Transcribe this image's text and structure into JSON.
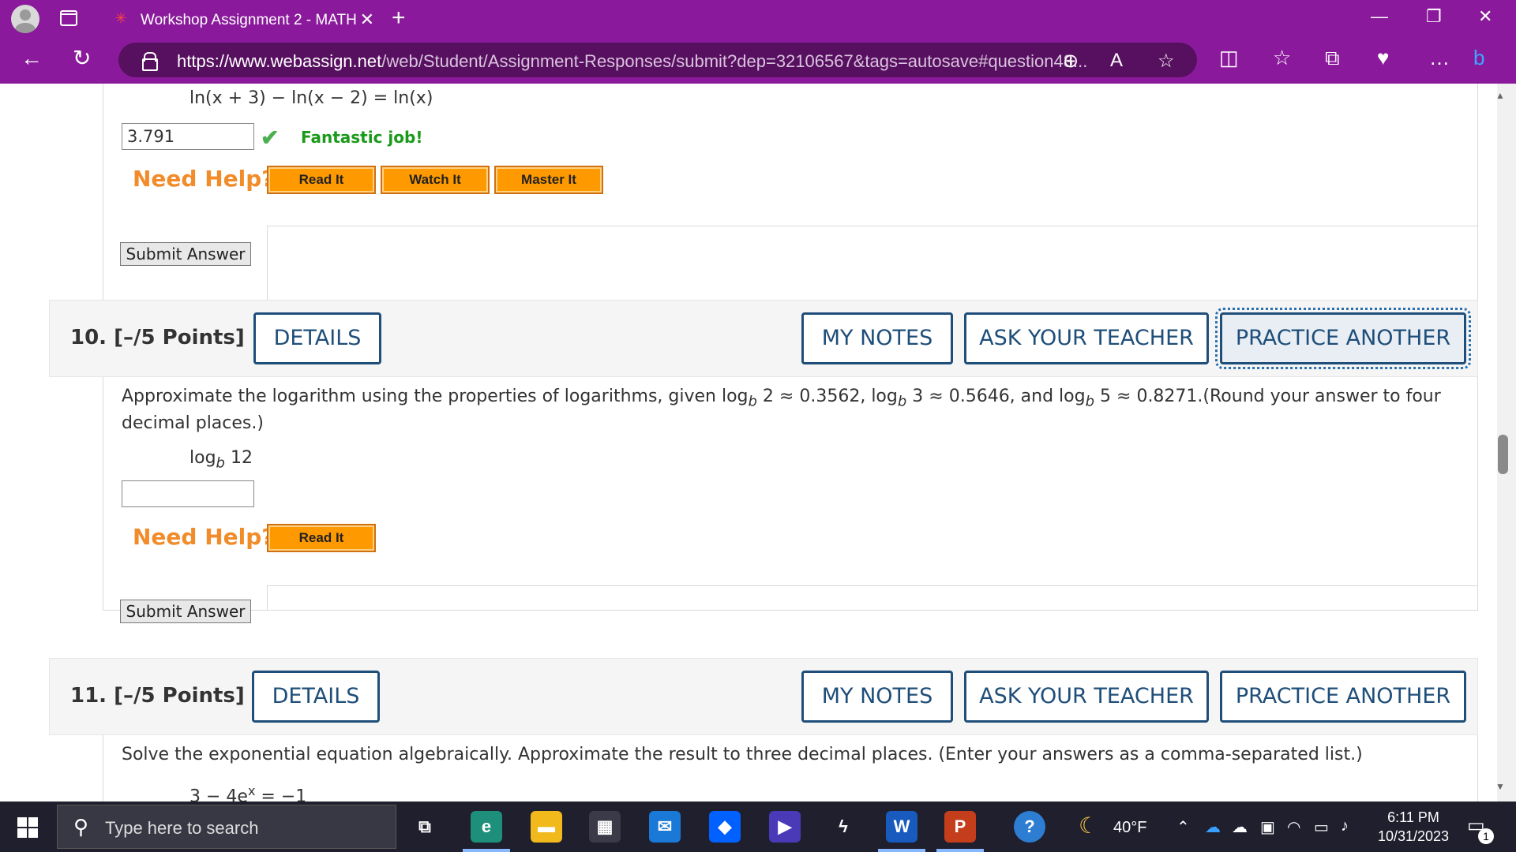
{
  "browser": {
    "tab_title": "Workshop Assignment 2 - MATH",
    "url_domain": "https://www.webassign.net",
    "url_path": "/web/Student/Assignment-Responses/submit?dep=32106567&tags=autosave#question48..."
  },
  "question9_partial": {
    "equation": "ln(x + 3) − ln(x − 2) = ln(x)",
    "answer_value": "3.791",
    "feedback": "Fantastic job!",
    "need_help": "Need Help?",
    "help_buttons": [
      "Read It",
      "Watch It",
      "Master It"
    ],
    "submit_label": "Submit Answer"
  },
  "question10": {
    "number": "10.",
    "points": "[–/5 Points]",
    "details_label": "DETAILS",
    "my_notes_label": "MY NOTES",
    "ask_teacher_label": "ASK YOUR TEACHER",
    "practice_label": "PRACTICE ANOTHER",
    "text_part1": "Approximate the logarithm using the properties of logarithms, given log",
    "sub_b": "b",
    "text_part2": " 2 ≈ 0.3562, log",
    "text_part3": " 3 ≈ 0.5646, and log",
    "text_part4": " 5 ≈ 0.8271.(Round your answer to four",
    "text_line2": "decimal places.)",
    "expr_log": "log",
    "expr_arg": " 12",
    "answer_value": "",
    "need_help": "Need Help?",
    "help_button": "Read It",
    "submit_label": "Submit Answer"
  },
  "question11": {
    "number": "11.",
    "points": "[–/5 Points]",
    "details_label": "DETAILS",
    "my_notes_label": "MY NOTES",
    "ask_teacher_label": "ASK YOUR TEACHER",
    "practice_label": "PRACTICE ANOTHER",
    "text": "Solve the exponential equation algebraically. Approximate the result to three decimal places. (Enter your answers as a comma-separated list.)",
    "equation_left": "3 − 4e",
    "equation_sup": "x",
    "equation_right": " = −1"
  },
  "taskbar": {
    "search_placeholder": "Type here to search",
    "weather": "40°F",
    "time": "6:11 PM",
    "date": "10/31/2023",
    "notification_count": "1",
    "word_letter": "W",
    "ppt_letter": "P"
  }
}
